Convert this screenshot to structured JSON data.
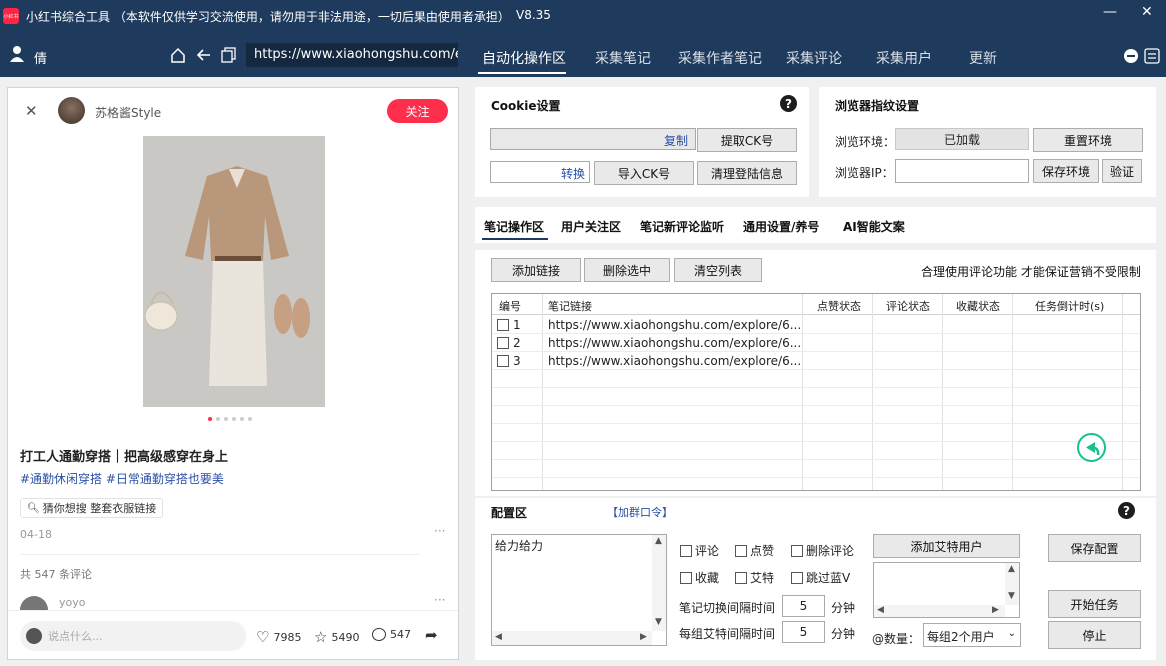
{
  "window": {
    "title": "小红书综合工具 （本软件仅供学习交流使用，请勿用于非法用途，一切后果由使用者承担）",
    "version": "V8.35",
    "logo_text": "小红书"
  },
  "nav": {
    "user_name": "倩",
    "url": "https://www.xiaohongshu.com/e",
    "tabs": [
      "自动化操作区",
      "采集笔记",
      "采集作者笔记",
      "采集评论",
      "采集用户",
      "更新"
    ]
  },
  "note": {
    "author": "苏格酱Style",
    "follow_label": "关注",
    "title": "打工人通勤穿搭｜把高级感穿在身上",
    "tags": "#通勤休闲穿搭 #日常通勤穿搭也要美",
    "search_chip": "猜你想搜 整套衣服链接",
    "date": "04-18",
    "comment_total": "共 547 条评论",
    "commenter": "yoyo",
    "comment_placeholder": "说点什么...",
    "likes": "7985",
    "stars": "5490",
    "comments": "547"
  },
  "cookie": {
    "title": "Cookie设置",
    "copy_label": "复制",
    "extract_label": "提取CK号",
    "convert_label": "转换",
    "import_label": "导入CK号",
    "clear_label": "清理登陆信息"
  },
  "fingerprint": {
    "title": "浏览器指纹设置",
    "env_label": "浏览环境：",
    "env_value": "已加载",
    "reset_label": "重置环境",
    "ip_label": "浏览器IP：",
    "save_env_label": "保存环境",
    "verify_label": "验证"
  },
  "subtabs": [
    "笔记操作区",
    "用户关注区",
    "笔记新评论监听",
    "通用设置/养号",
    "AI智能文案"
  ],
  "notes_area": {
    "add_link": "添加链接",
    "delete_selected": "删除选中",
    "clear_list": "清空列表",
    "notice": "合理使用评论功能 才能保证营销不受限制",
    "columns": [
      "编号",
      "笔记链接",
      "点赞状态",
      "评论状态",
      "收藏状态",
      "任务倒计时(s)"
    ],
    "rows": [
      {
        "id": "1",
        "url": "https://www.xiaohongshu.com/explore/6..."
      },
      {
        "id": "2",
        "url": "https://www.xiaohongshu.com/explore/6..."
      },
      {
        "id": "3",
        "url": "https://www.xiaohongshu.com/explore/6..."
      }
    ]
  },
  "config": {
    "title": "配置区",
    "group_link": "【加群口令】",
    "text_content": "给力给力",
    "checks": [
      "评论",
      "点赞",
      "删除评论",
      "收藏",
      "艾特",
      "跳过蓝V"
    ],
    "add_at_user": "添加艾特用户",
    "interval_label": "笔记切换间隔时间",
    "interval_value": "5",
    "interval_unit": "分钟",
    "group_interval_label": "每组艾特间隔时间",
    "group_interval_value": "5",
    "group_interval_unit": "分钟",
    "count_label": "@数量：",
    "count_value": "每组2个用户",
    "save_config": "保存配置",
    "start_task": "开始任务",
    "stop": "停止"
  },
  "colors": {
    "titlebar": "#1e3a5c",
    "follow": "#ff2e4d",
    "accent_teal": "#1bbf8f",
    "link_blue": "#2a4fa8"
  }
}
